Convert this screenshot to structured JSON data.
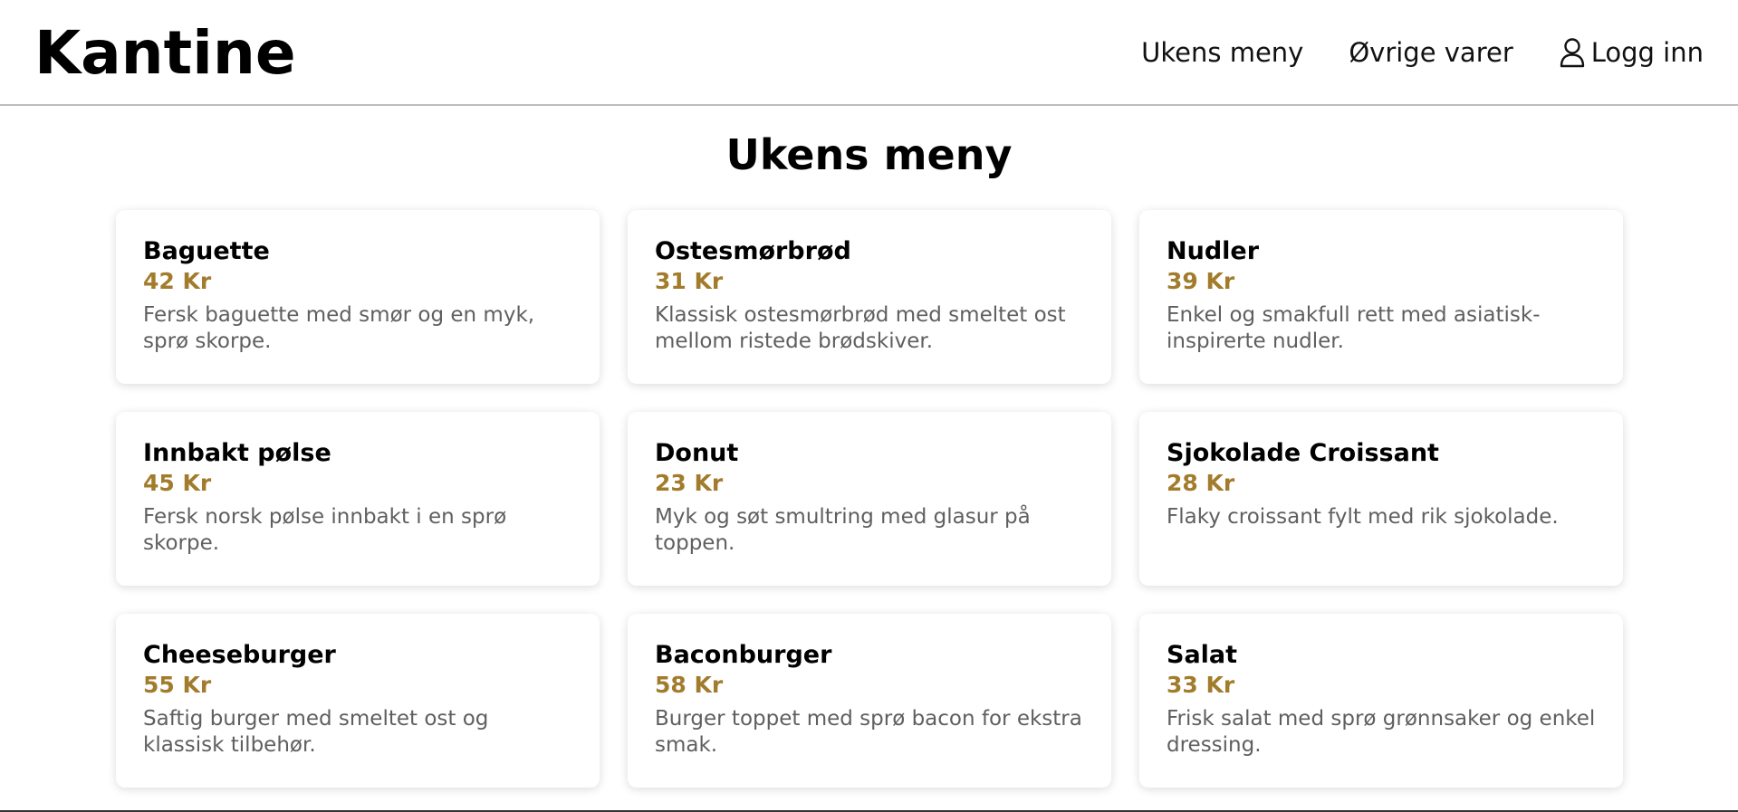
{
  "header": {
    "logo": "Kantine",
    "nav": {
      "weekly_menu": "Ukens meny",
      "other_items": "Øvrige varer",
      "login": "Logg inn"
    }
  },
  "main": {
    "title": "Ukens meny",
    "items": [
      {
        "name": "Baguette",
        "price": "42 Kr",
        "description": "Fersk baguette med smør og en myk, sprø skorpe."
      },
      {
        "name": "Ostesmørbrød",
        "price": "31 Kr",
        "description": "Klassisk ostesmørbrød med smeltet ost mellom ristede brødskiver."
      },
      {
        "name": "Nudler",
        "price": "39 Kr",
        "description": "Enkel og smakfull rett med asiatisk-inspirerte nudler."
      },
      {
        "name": "Innbakt pølse",
        "price": "45 Kr",
        "description": "Fersk norsk pølse innbakt i en sprø skorpe."
      },
      {
        "name": "Donut",
        "price": "23 Kr",
        "description": "Myk og søt smultring med glasur på toppen."
      },
      {
        "name": "Sjokolade Croissant",
        "price": "28 Kr",
        "description": "Flaky croissant fylt med rik sjokolade."
      },
      {
        "name": "Cheeseburger",
        "price": "55 Kr",
        "description": "Saftig burger med smeltet ost og klassisk tilbehør."
      },
      {
        "name": "Baconburger",
        "price": "58 Kr",
        "description": "Burger toppet med sprø bacon for ekstra smak."
      },
      {
        "name": "Salat",
        "price": "33 Kr",
        "description": "Frisk salat med sprø grønnsaker og enkel dressing."
      }
    ]
  },
  "colors": {
    "price": "#a27c2c",
    "description": "#5f5f5f",
    "header_border": "#bdbdbd"
  },
  "icons": {
    "login": "user-icon"
  }
}
